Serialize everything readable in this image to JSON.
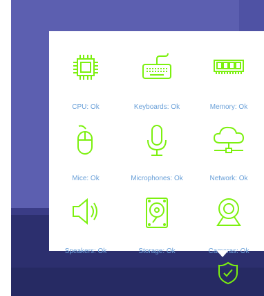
{
  "colors": {
    "icon": "#7cf00f",
    "label": "#6aa0d8",
    "desktop": "#5c5fb0",
    "taskbar": "#262a63"
  },
  "devices": [
    {
      "label": "CPU: Ok",
      "icon": "cpu-icon"
    },
    {
      "label": "Keyboards: Ok",
      "icon": "keyboard-icon"
    },
    {
      "label": "Memory: Ok",
      "icon": "memory-icon"
    },
    {
      "label": "Mice: Ok",
      "icon": "mouse-icon"
    },
    {
      "label": "Microphones: Ok",
      "icon": "microphone-icon"
    },
    {
      "label": "Network: Ok",
      "icon": "network-icon"
    },
    {
      "label": "Speakers: Ok",
      "icon": "speaker-icon"
    },
    {
      "label": "Storage: Ok",
      "icon": "storage-icon"
    },
    {
      "label": "Cameras: Ok",
      "icon": "camera-icon"
    }
  ],
  "tray": {
    "icon": "shield-check-icon"
  }
}
